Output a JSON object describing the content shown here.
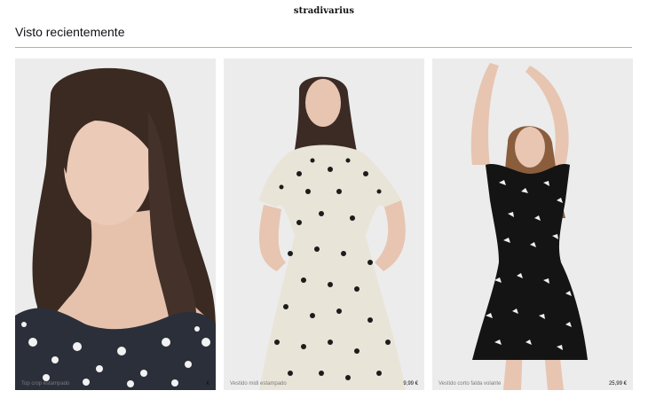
{
  "header": {
    "logo_text": "stradivarius"
  },
  "section": {
    "title": "Visto recientemente",
    "accent_color": "#7ed957"
  },
  "products": [
    {
      "name": "Top crop estampado",
      "price": "",
      "visible_price_fragment": "€"
    },
    {
      "name": "Vestido midi estampado",
      "price": "",
      "visible_price_fragment": "9,99 €"
    },
    {
      "name": "Vestido corto falda volante",
      "price": "25,99 €"
    }
  ]
}
